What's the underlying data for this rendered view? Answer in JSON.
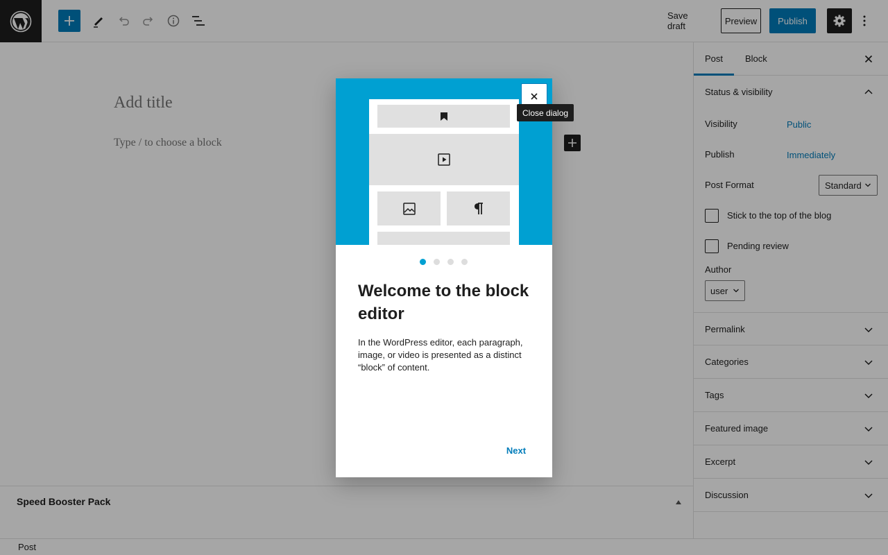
{
  "toolbar": {
    "save_draft": "Save draft",
    "preview": "Preview",
    "publish": "Publish"
  },
  "editor": {
    "title_placeholder": "Add title",
    "block_placeholder": "Type / to choose a block"
  },
  "metabox": {
    "title": "Speed Booster Pack"
  },
  "footer": {
    "breadcrumb": "Post"
  },
  "sidebar": {
    "tabs": [
      {
        "label": "Post",
        "active": true
      },
      {
        "label": "Block",
        "active": false
      }
    ],
    "status_panel": {
      "title": "Status & visibility",
      "visibility_label": "Visibility",
      "visibility_value": "Public",
      "publish_label": "Publish",
      "publish_value": "Immediately",
      "format_label": "Post Format",
      "format_value": "Standard",
      "sticky_label": "Stick to the top of the blog",
      "sticky_checked": false,
      "pending_label": "Pending review",
      "pending_checked": false,
      "author_label": "Author",
      "author_value": "user"
    },
    "panels": [
      {
        "label": "Permalink"
      },
      {
        "label": "Categories"
      },
      {
        "label": "Tags"
      },
      {
        "label": "Featured image"
      },
      {
        "label": "Excerpt"
      },
      {
        "label": "Discussion"
      }
    ]
  },
  "guide": {
    "tooltip": "Close dialog",
    "heading": "Welcome to the block editor",
    "body": "In the WordPress editor, each paragraph, image, or video is presented as a distinct “block” of content.",
    "next": "Next",
    "pages": 4,
    "current_page": 1
  },
  "colors": {
    "accent": "#007cba",
    "hero": "#00a0d2",
    "dark": "#1e1e1e"
  }
}
